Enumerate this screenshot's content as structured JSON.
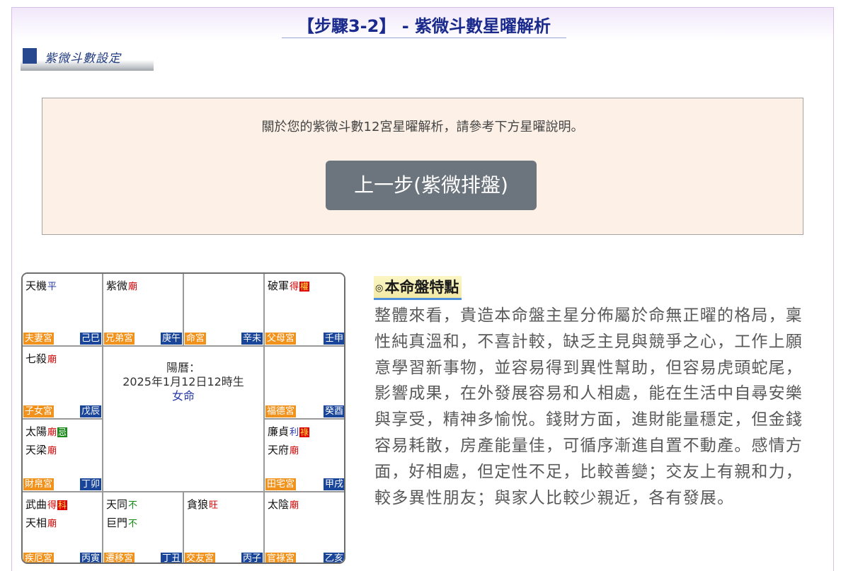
{
  "page": {
    "title": "【步驟3-2】 - 紫微斗數星曜解析",
    "section_banner": "紫微斗數設定"
  },
  "info": {
    "text": "關於您的紫微斗數12宮星曜解析，請參考下方星曜說明。",
    "prev_button": "上一步(紫微排盤)"
  },
  "chart": {
    "center": {
      "calendar_label": "陽曆：",
      "birth": "2025年1月12日12時生",
      "gender": "女命"
    },
    "palaces": [
      {
        "name": "夫妻宮",
        "ganzhi": "己巳",
        "stars": [
          {
            "name": "天機",
            "brightness": "平",
            "brightness_color": "blue"
          }
        ]
      },
      {
        "name": "兄弟宮",
        "ganzhi": "庚午",
        "stars": [
          {
            "name": "紫微",
            "brightness": "廟",
            "brightness_color": "red"
          }
        ]
      },
      {
        "name": "命宮",
        "ganzhi": "辛未",
        "stars": []
      },
      {
        "name": "父母宮",
        "ganzhi": "壬申",
        "stars": [
          {
            "name": "破軍",
            "brightness": "得",
            "brightness_color": "red",
            "hua": "權",
            "hua_type": "quan"
          }
        ]
      },
      {
        "name": "子女宮",
        "ganzhi": "戊辰",
        "stars": [
          {
            "name": "七殺",
            "brightness": "廟",
            "brightness_color": "red"
          }
        ]
      },
      {
        "name": "福德宮",
        "ganzhi": "癸酉",
        "stars": []
      },
      {
        "name": "財帛宮",
        "ganzhi": "丁卯",
        "stars": [
          {
            "name": "太陽",
            "brightness": "廟",
            "brightness_color": "red",
            "hua": "忌",
            "hua_type": "ji"
          },
          {
            "name": "天梁",
            "brightness": "廟",
            "brightness_color": "red"
          }
        ]
      },
      {
        "name": "田宅宮",
        "ganzhi": "甲戌",
        "stars": [
          {
            "name": "廉貞",
            "brightness": "利",
            "brightness_color": "blue",
            "hua": "祿",
            "hua_type": "lu"
          },
          {
            "name": "天府",
            "brightness": "廟",
            "brightness_color": "red"
          }
        ]
      },
      {
        "name": "疾厄宮",
        "ganzhi": "丙寅",
        "stars": [
          {
            "name": "武曲",
            "brightness": "得",
            "brightness_color": "red",
            "hua": "科",
            "hua_type": "ke"
          },
          {
            "name": "天相",
            "brightness": "廟",
            "brightness_color": "red"
          }
        ]
      },
      {
        "name": "遷移宮",
        "ganzhi": "丁丑",
        "stars": [
          {
            "name": "天同",
            "brightness": "不",
            "brightness_color": "green"
          },
          {
            "name": "巨門",
            "brightness": "不",
            "brightness_color": "green"
          }
        ]
      },
      {
        "name": "交友宮",
        "ganzhi": "丙子",
        "stars": [
          {
            "name": "貪狼",
            "brightness": "旺",
            "brightness_color": "red"
          }
        ]
      },
      {
        "name": "官祿宮",
        "ganzhi": "乙亥",
        "stars": [
          {
            "name": "太陰",
            "brightness": "廟",
            "brightness_color": "red"
          }
        ]
      }
    ]
  },
  "feature": {
    "heading": "本命盤特點",
    "heading_icon": "bullseye-icon",
    "body": "整體來看，貴造本命盤主星分佈屬於命無正曜的格局，稟性純真溫和，不喜計較，缺乏主見與競爭之心，工作上願意學習新事物，並容易得到異性幫助，但容易虎頭蛇尾，影響成果，在外發展容易和人相處，能在生活中自尋安樂與享受，精神多愉悅。錢財方面，進財能量穩定，但金錢容易耗散，房產能量佳，可循序漸進自置不動產。感情方面，好相處，但定性不足，比較善變；交友上有親和力，較多異性朋友；與家人比較少親近，各有發展。"
  },
  "colors": {
    "title": "#1a2a8c",
    "info_bg": "#fdf0e6",
    "button_bg": "#6c757d",
    "palace_label_bg": "#f0921c",
    "ganzhi_bg": "#19459b",
    "brightness_red": "#d00000",
    "brightness_green": "#118811",
    "brightness_blue": "#2a3aa8"
  }
}
